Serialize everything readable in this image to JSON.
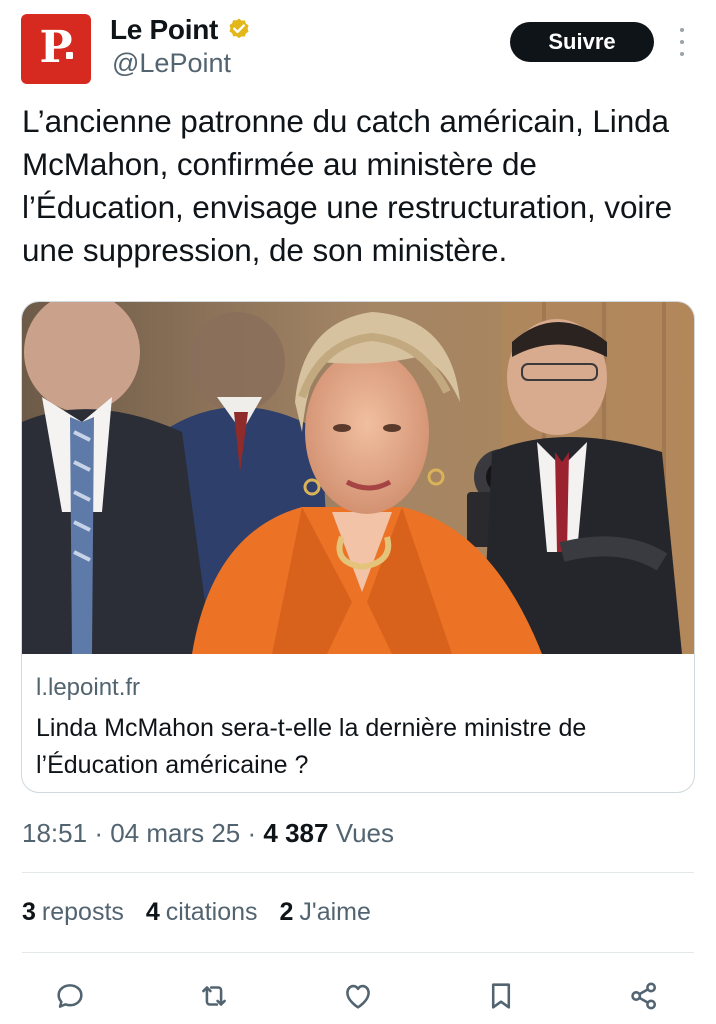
{
  "account": {
    "display_name": "Le Point",
    "handle": "@LePoint",
    "logo_letter": "P",
    "verified_color": "#E2B719"
  },
  "follow_label": "Suivre",
  "tweet": {
    "text": "L’ancienne patronne du catch américain, Linda McMahon, confirmée au ministère de l’Éducation, envisage une restructuration, voire une suppression, de son ministère."
  },
  "card": {
    "domain": "l.lepoint.fr",
    "title": "Linda McMahon sera-t-elle la dernière ministre de l’Éducation américaine ?"
  },
  "meta": {
    "time": "18:51",
    "date": "04 mars 25",
    "views_count": "4 387",
    "views_label": "Vues"
  },
  "stats": {
    "reposts_count": "3",
    "reposts_label": "reposts",
    "quotes_count": "4",
    "quotes_label": "citations",
    "likes_count": "2",
    "likes_label": "J'aime"
  },
  "actions": [
    "reply-icon",
    "retweet-icon",
    "like-icon",
    "bookmark-icon",
    "share-icon"
  ],
  "colors": {
    "brand_red": "#D6291F",
    "text": "#0F1419",
    "secondary": "#536471",
    "button_bg": "#0F1419"
  }
}
